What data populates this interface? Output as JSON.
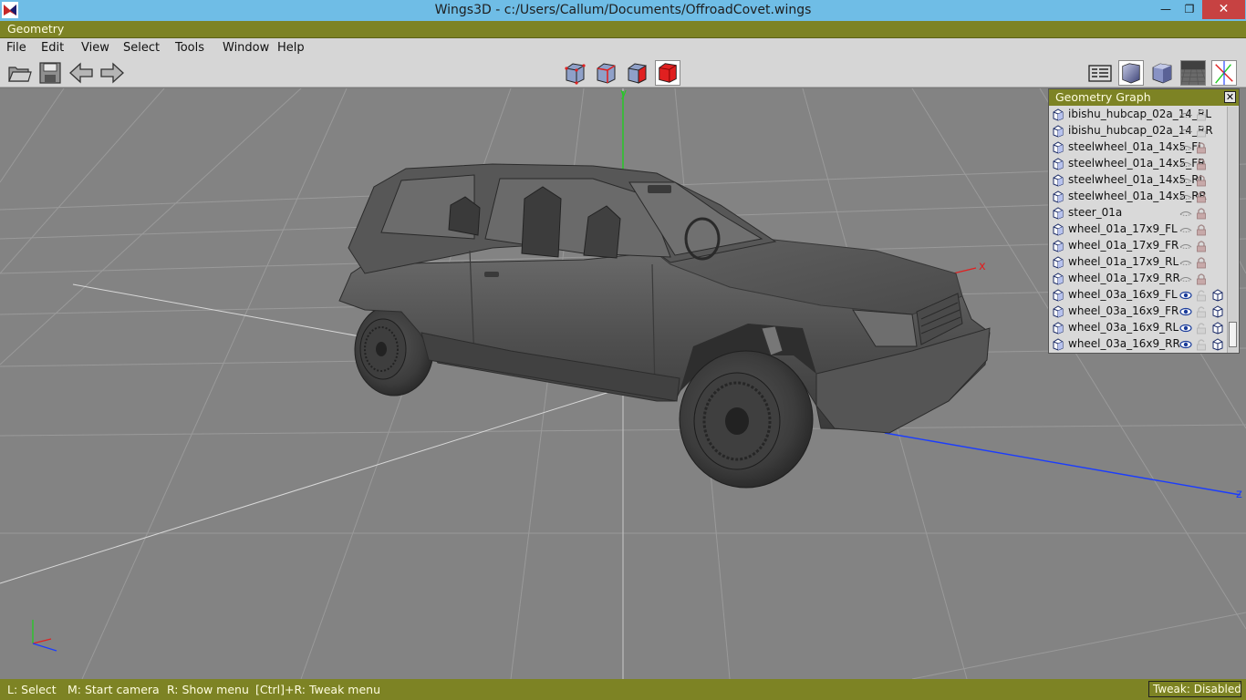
{
  "window": {
    "title": "Wings3D - c:/Users/Callum/Documents/OffroadCovet.wings",
    "minimize": "—",
    "maximize": "❐",
    "close": "✕"
  },
  "geometry_bar": {
    "label": "Geometry"
  },
  "menu": {
    "file": "File",
    "edit": "Edit",
    "view": "View",
    "select": "Select",
    "tools": "Tools",
    "window": "Window",
    "help": "Help"
  },
  "toolbar": {
    "left_icons": [
      "open-folder-icon",
      "save-icon",
      "undo-arrow-icon",
      "redo-arrow-icon"
    ],
    "selection_modes": [
      "vertex-mode-icon",
      "edge-mode-icon",
      "face-mode-icon",
      "body-mode-icon"
    ],
    "active_selection_mode": "body",
    "right_icons": [
      "orthographic-icon",
      "smooth-shading-icon",
      "flat-shading-icon",
      "ground-plane-icon",
      "axes-icon"
    ],
    "selection_red": "#e02020"
  },
  "viewport": {
    "axis_labels": {
      "x": "x",
      "y": "y",
      "z": "z"
    },
    "colors": {
      "x_axis": "#e02020",
      "y_axis": "#22cc22",
      "z_axis": "#1a3cff"
    }
  },
  "geometry_graph": {
    "title": "Geometry Graph",
    "close": "✕",
    "objects": [
      {
        "name": "ibishu_hubcap_02a_14_RL",
        "visible": false,
        "locked": false,
        "wire": false
      },
      {
        "name": "ibishu_hubcap_02a_14_RR",
        "visible": false,
        "locked": false,
        "wire": false
      },
      {
        "name": "steelwheel_01a_14x5_FL",
        "visible": false,
        "locked": true,
        "wire": false
      },
      {
        "name": "steelwheel_01a_14x5_FR",
        "visible": false,
        "locked": true,
        "wire": false
      },
      {
        "name": "steelwheel_01a_14x5_RL",
        "visible": false,
        "locked": true,
        "wire": false
      },
      {
        "name": "steelwheel_01a_14x5_RR",
        "visible": false,
        "locked": true,
        "wire": false
      },
      {
        "name": "steer_01a",
        "visible": false,
        "locked": true,
        "wire": false
      },
      {
        "name": "wheel_01a_17x9_FL",
        "visible": false,
        "locked": true,
        "wire": false
      },
      {
        "name": "wheel_01a_17x9_FR",
        "visible": false,
        "locked": true,
        "wire": false
      },
      {
        "name": "wheel_01a_17x9_RL",
        "visible": false,
        "locked": true,
        "wire": false
      },
      {
        "name": "wheel_01a_17x9_RR",
        "visible": false,
        "locked": true,
        "wire": false
      },
      {
        "name": "wheel_03a_16x9_FL",
        "visible": true,
        "locked": false,
        "wire": true
      },
      {
        "name": "wheel_03a_16x9_FR",
        "visible": true,
        "locked": false,
        "wire": true
      },
      {
        "name": "wheel_03a_16x9_RL",
        "visible": true,
        "locked": false,
        "wire": true
      },
      {
        "name": "wheel_03a_16x9_RR",
        "visible": true,
        "locked": false,
        "wire": true
      }
    ]
  },
  "status_bar": {
    "select": "L: Select",
    "camera": "M: Start camera",
    "menu": "R: Show menu",
    "tweak_menu": "[Ctrl]+R: Tweak menu",
    "tweak_state": "Tweak: Disabled"
  }
}
